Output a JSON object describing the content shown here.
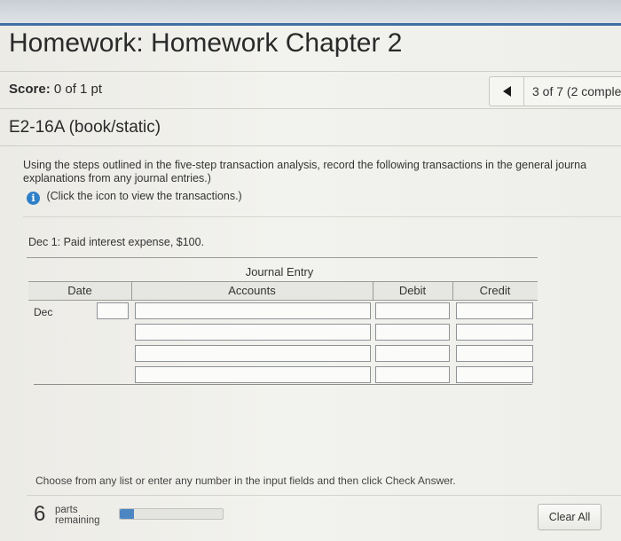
{
  "header": {
    "title": "Homework: Homework Chapter 2",
    "score_label": "Score:",
    "score_value": "0 of 1 pt",
    "progress_text": "3 of 7 (2 comple"
  },
  "question": {
    "title": "E2-16A (book/static)",
    "instructions_line1": "Using the steps outlined in the five-step transaction analysis, record the following transactions in the general journa",
    "instructions_line2": "explanations from any journal entries.)",
    "info_link": "(Click the icon to view the transactions.)",
    "transaction": "Dec 1: Paid interest expense, $100."
  },
  "journal": {
    "caption": "Journal Entry",
    "col_date": "Date",
    "col_accounts": "Accounts",
    "col_debit": "Debit",
    "col_credit": "Credit",
    "row_month": "Dec"
  },
  "footer": {
    "hint": "Choose from any list or enter any number in the input fields and then click Check Answer.",
    "parts_count": "6",
    "parts_line1": "parts",
    "parts_line2": "remaining",
    "parts_progress_fraction": 0.14,
    "clear_label": "Clear All"
  },
  "colors": {
    "accent": "#3f6fa3",
    "info_icon": "#2f7fc8",
    "progress": "#4c86c2"
  },
  "icons": {
    "prev": "triangle-left-icon",
    "info": "info-icon"
  }
}
